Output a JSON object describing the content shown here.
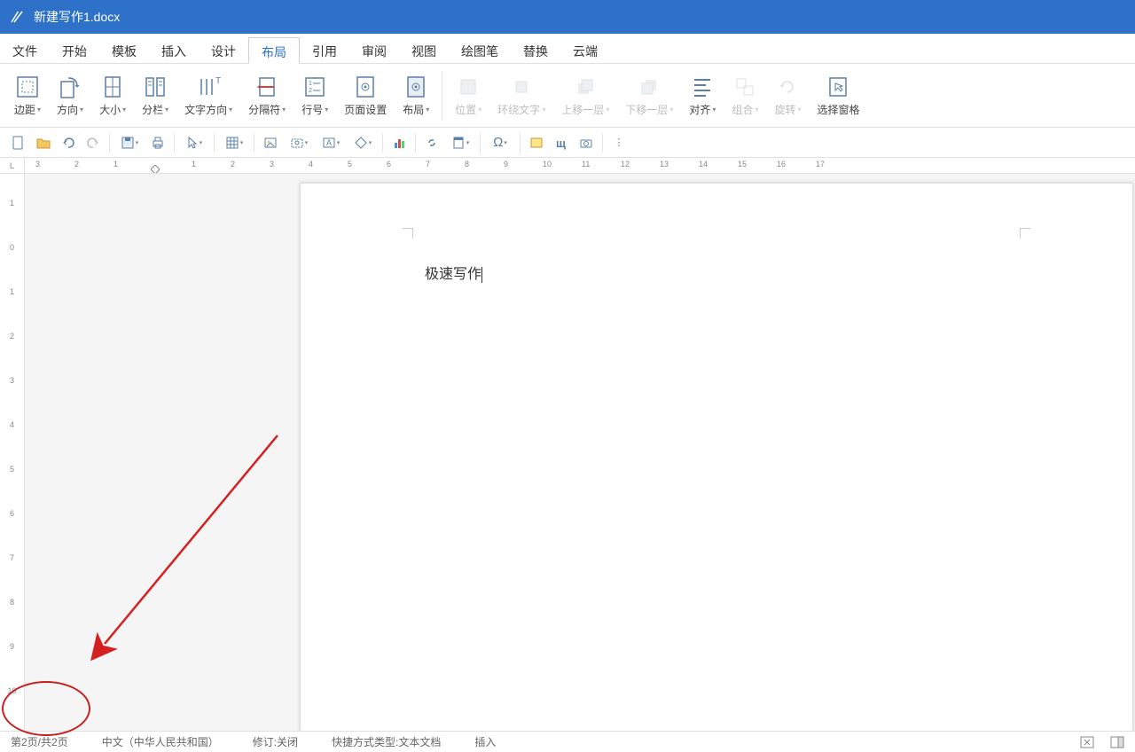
{
  "title_bar": {
    "filename": "新建写作1.docx"
  },
  "menu": {
    "items": [
      "文件",
      "开始",
      "模板",
      "插入",
      "设计",
      "布局",
      "引用",
      "审阅",
      "视图",
      "绘图笔",
      "替换",
      "云端"
    ],
    "active_index": 5
  },
  "ribbon": {
    "groups": {
      "page_setup": {
        "margins": "边距",
        "orientation": "方向",
        "size": "大小",
        "columns": "分栏",
        "text_direction": "文字方向",
        "breaks": "分隔符",
        "line_numbers": "行号",
        "page_setup": "页面设置",
        "background": "布局"
      },
      "arrange": {
        "position": "位置",
        "wrap": "环绕文字",
        "bring_forward": "上移一层",
        "send_backward": "下移一层",
        "align": "对齐",
        "group": "组合",
        "rotate": "旋转",
        "selection_pane": "选择窗格"
      }
    }
  },
  "document": {
    "content": "极速写作"
  },
  "status": {
    "page": "第2页/共2页",
    "language": "中文（中华人民共和国）",
    "track": "修订:关闭",
    "shortcut": "快捷方式类型:文本文档",
    "mode": "插入"
  },
  "hruler": {
    "labels": [
      "3",
      "2",
      "1",
      "",
      "1",
      "2",
      "3",
      "4",
      "5",
      "6",
      "7",
      "8",
      "9",
      "10",
      "11",
      "12",
      "13",
      "14",
      "15",
      "16",
      "17"
    ]
  },
  "vruler": {
    "labels": [
      "1",
      "0",
      "1",
      "2",
      "3",
      "4",
      "5",
      "6",
      "7",
      "8",
      "9",
      "10"
    ]
  }
}
